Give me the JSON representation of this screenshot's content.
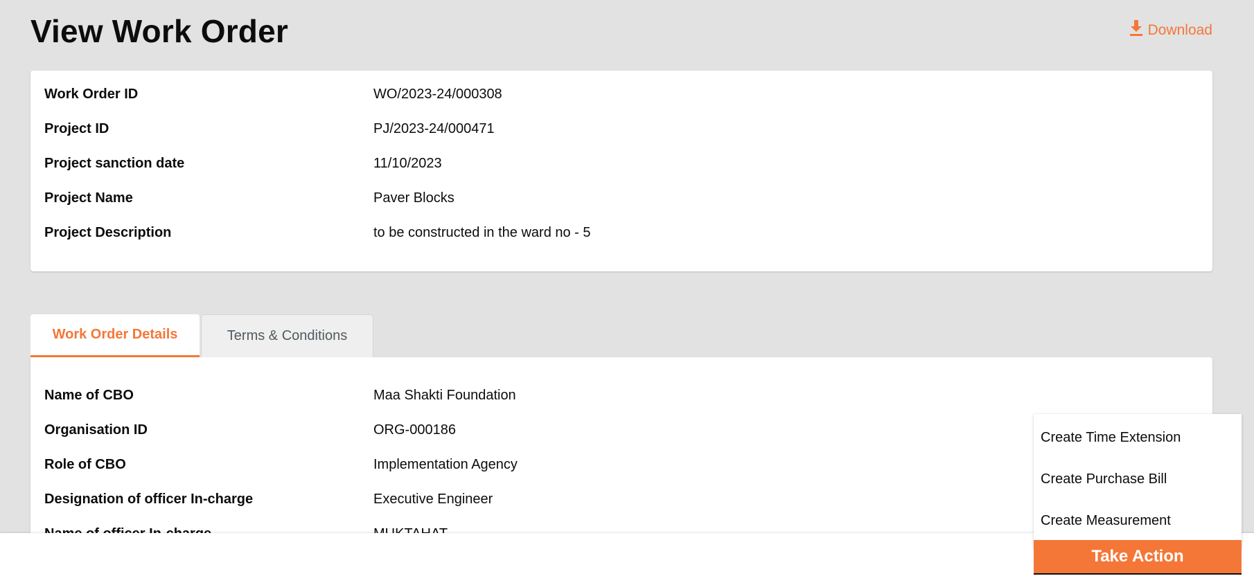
{
  "header": {
    "title": "View Work Order",
    "download_label": "Download"
  },
  "summary": [
    {
      "label": "Work Order ID",
      "value": "WO/2023-24/000308"
    },
    {
      "label": "Project ID",
      "value": "PJ/2023-24/000471"
    },
    {
      "label": "Project sanction date",
      "value": "11/10/2023"
    },
    {
      "label": "Project Name",
      "value": "Paver Blocks"
    },
    {
      "label": "Project Description",
      "value": "to be constructed in the ward no - 5"
    }
  ],
  "tabs": [
    {
      "label": "Work Order Details",
      "active": true
    },
    {
      "label": "Terms & Conditions",
      "active": false
    }
  ],
  "details": [
    {
      "label": "Name of CBO",
      "value": "Maa Shakti Foundation"
    },
    {
      "label": "Organisation ID",
      "value": "ORG-000186"
    },
    {
      "label": "Role of CBO",
      "value": "Implementation Agency"
    },
    {
      "label": "Designation of officer In-charge",
      "value": "Executive Engineer"
    },
    {
      "label": "Name of officer In-charge",
      "value": "MUKTAHAT"
    }
  ],
  "action_menu": {
    "items": [
      "Create Time Extension",
      "Create Purchase Bill",
      "Create Measurement"
    ],
    "button_label": "Take Action"
  },
  "colors": {
    "accent": "#f47738",
    "background": "#e2e2e2",
    "text": "#0b0c0c"
  },
  "icons": {
    "download": "download-icon"
  }
}
